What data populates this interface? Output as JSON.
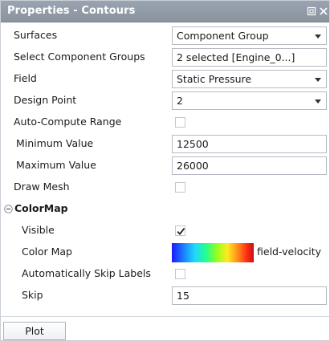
{
  "window": {
    "title": "Properties - Contours",
    "restore_icon": "undock-icon",
    "close_icon": "close-icon",
    "title_bar_color": "#939daa"
  },
  "properties": {
    "surfaces": {
      "label": "Surfaces",
      "value": "Component Group"
    },
    "select_component_groups": {
      "label": "Select Component Groups",
      "value": "2 selected [Engine_0...]"
    },
    "field": {
      "label": "Field",
      "value": "Static Pressure"
    },
    "design_point": {
      "label": "Design Point",
      "value": "2"
    },
    "auto_compute_range": {
      "label": "Auto-Compute Range",
      "checked": false
    },
    "minimum_value": {
      "label": "Minimum Value",
      "value": "12500"
    },
    "maximum_value": {
      "label": "Maximum Value",
      "value": "26000"
    },
    "draw_mesh": {
      "label": "Draw Mesh",
      "checked": false
    }
  },
  "colormap": {
    "section_title": "ColorMap",
    "collapse_icon": "collapse-minus-icon",
    "visible": {
      "label": "Visible",
      "checked": true
    },
    "color_map": {
      "label": "Color Map",
      "name": "field-velocity"
    },
    "auto_skip_labels": {
      "label": "Automatically Skip Labels",
      "checked": false
    },
    "skip": {
      "label": "Skip",
      "value": "15"
    }
  },
  "footer": {
    "plot_label": "Plot"
  }
}
